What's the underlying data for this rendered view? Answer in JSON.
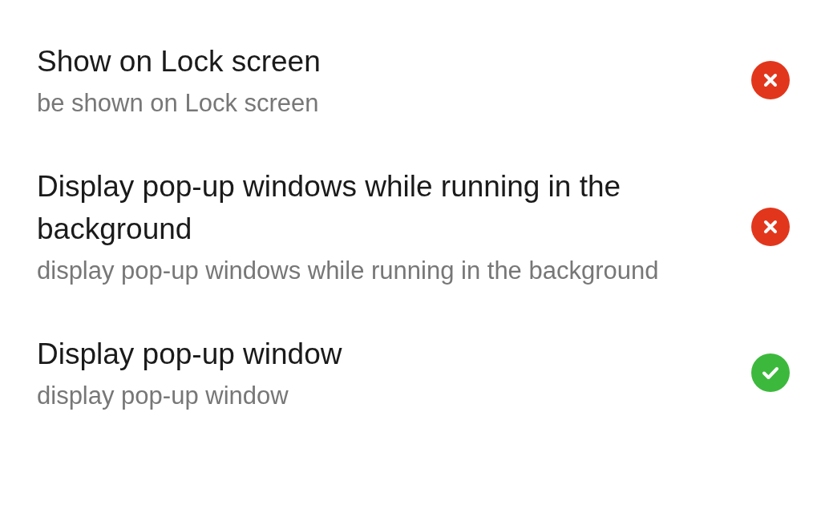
{
  "permissions": [
    {
      "title": "Show on Lock screen",
      "description": "be shown on Lock screen",
      "allowed": false
    },
    {
      "title": "Display pop-up windows while running in the background",
      "description": "display pop-up windows while running in the background",
      "allowed": false
    },
    {
      "title": "Display pop-up window",
      "description": "display pop-up window",
      "allowed": true
    }
  ]
}
